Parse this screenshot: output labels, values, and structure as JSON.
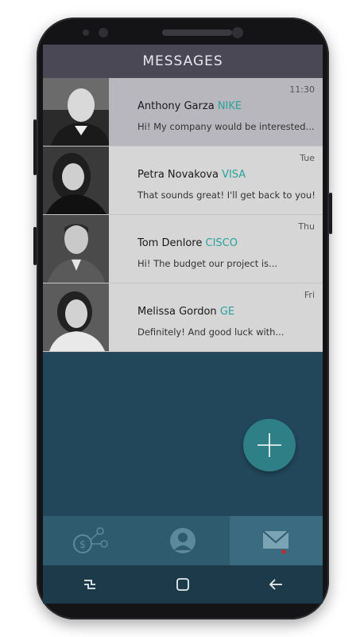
{
  "header": {
    "title": "MESSAGES"
  },
  "messages": [
    {
      "time": "11:30",
      "name": "Anthony Garza",
      "company": "NIKE",
      "preview": "Hi! My company would be interested..."
    },
    {
      "time": "Tue",
      "name": "Petra Novakova",
      "company": "VISA",
      "preview": "That sounds great! I'll get back to you!"
    },
    {
      "time": "Thu",
      "name": "Tom Denlore",
      "company": "CISCO",
      "preview": "Hi! The budget our project is..."
    },
    {
      "time": "Fri",
      "name": "Melissa Gordon",
      "company": "GE",
      "preview": "Definitely! And good luck with..."
    }
  ],
  "fab": {
    "icon": "plus-icon"
  },
  "tabs": [
    {
      "icon": "dollar-network-icon"
    },
    {
      "icon": "user-profile-icon"
    },
    {
      "icon": "mail-icon",
      "selected": true,
      "badge_color": "#d6232a"
    }
  ],
  "colors": {
    "accent": "#2aa39a",
    "header_bg": "#4b4856",
    "screen_bg": "#22475a",
    "fab_bg": "#2f7f86"
  }
}
